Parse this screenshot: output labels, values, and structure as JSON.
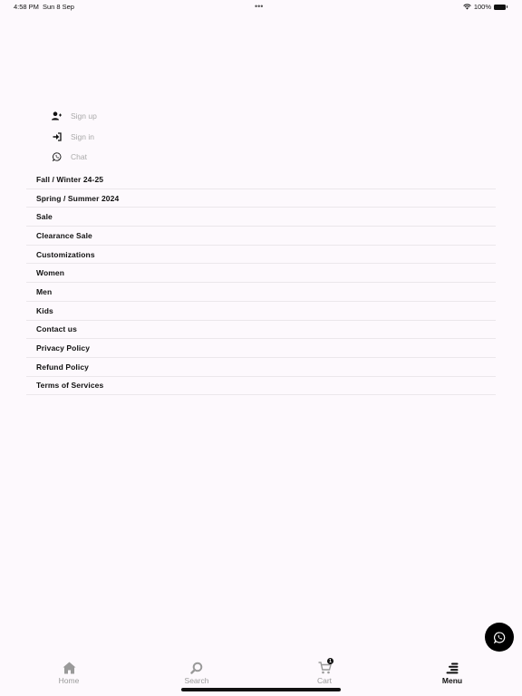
{
  "status_bar": {
    "time": "4:58 PM",
    "date": "Sun 8 Sep",
    "multitask_dots": "•••",
    "battery_percent": "100%"
  },
  "account": {
    "items": [
      {
        "label": "Sign up",
        "icon": "add-user-icon"
      },
      {
        "label": "Sign in",
        "icon": "sign-in-icon"
      },
      {
        "label": "Chat",
        "icon": "whatsapp-icon"
      }
    ]
  },
  "menu": {
    "items": [
      {
        "label": "Fall / Winter 24-25"
      },
      {
        "label": "Spring / Summer 2024"
      },
      {
        "label": "Sale"
      },
      {
        "label": "Clearance Sale"
      },
      {
        "label": "Customizations"
      },
      {
        "label": "Women"
      },
      {
        "label": "Men"
      },
      {
        "label": "Kids"
      },
      {
        "label": "Contact us"
      },
      {
        "label": "Privacy Policy"
      },
      {
        "label": "Refund Policy"
      },
      {
        "label": "Terms of Services"
      }
    ]
  },
  "tabbar": {
    "tabs": [
      {
        "label": "Home",
        "icon": "home-icon",
        "active": false
      },
      {
        "label": "Search",
        "icon": "search-icon",
        "active": false
      },
      {
        "label": "Cart",
        "icon": "cart-icon",
        "active": false,
        "badge": "1"
      },
      {
        "label": "Menu",
        "icon": "menu-icon",
        "active": true
      }
    ]
  },
  "colors": {
    "background": "#fdf9fd",
    "text": "#111111",
    "muted": "#aaaaaa",
    "inactive_tab": "#9a9a9a",
    "divider": "#ebe7eb"
  }
}
